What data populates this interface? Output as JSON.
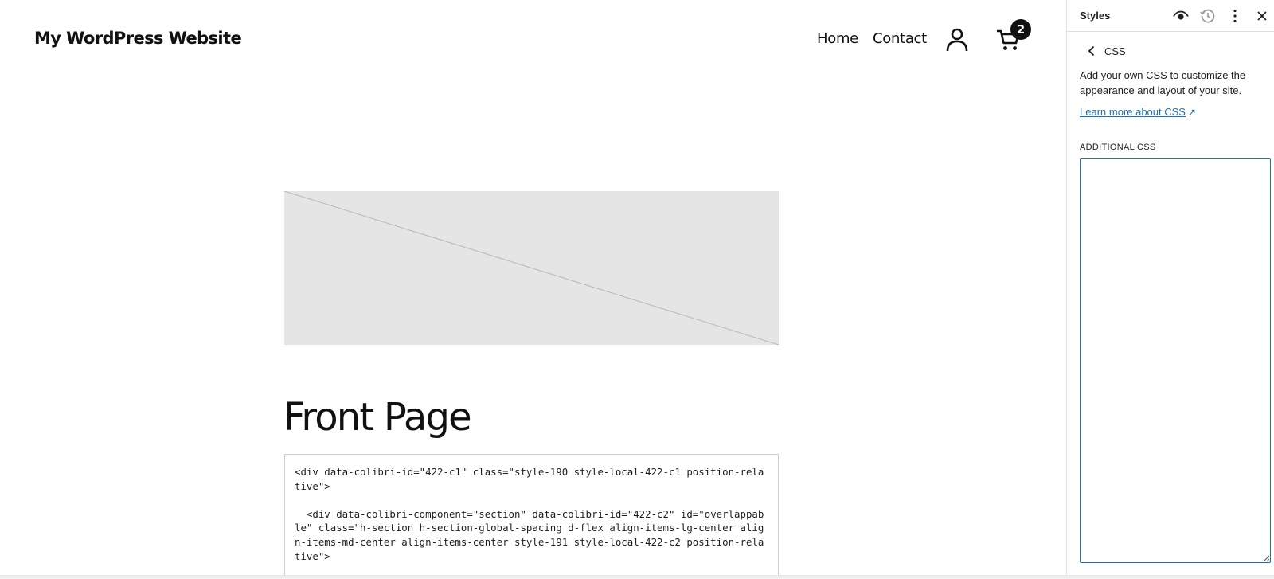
{
  "site": {
    "title": "My WordPress Website",
    "nav": [
      {
        "label": "Home"
      },
      {
        "label": "Contact"
      }
    ],
    "cart_count": "2"
  },
  "content": {
    "page_title": "Front Page",
    "code_snippet": "<div data-colibri-id=\"422-c1\" class=\"style-190 style-local-422-c1 position-relative\">\n\n  <div data-colibri-component=\"section\" data-colibri-id=\"422-c2\" id=\"overlappable\" class=\"h-section h-section-global-spacing d-flex align-items-lg-center align-items-md-center align-items-center style-191 style-local-422-c2 position-relative\">"
  },
  "sidebar": {
    "title": "Styles",
    "section_title": "CSS",
    "description": "Add your own CSS to customize the appearance and layout of your site.",
    "learn_more": "Learn more about CSS",
    "learn_more_arrow": "↗",
    "field_label": "ADDITIONAL CSS",
    "css_value": "",
    "icons": [
      "eye-icon",
      "revisions-icon",
      "more-options-icon",
      "close-icon",
      "back-arrow-icon"
    ]
  },
  "colors": {
    "link": "#2271b1",
    "text": "#1e1e1e",
    "placeholder_bg": "#e5e5e5",
    "badge_bg": "#111111"
  }
}
